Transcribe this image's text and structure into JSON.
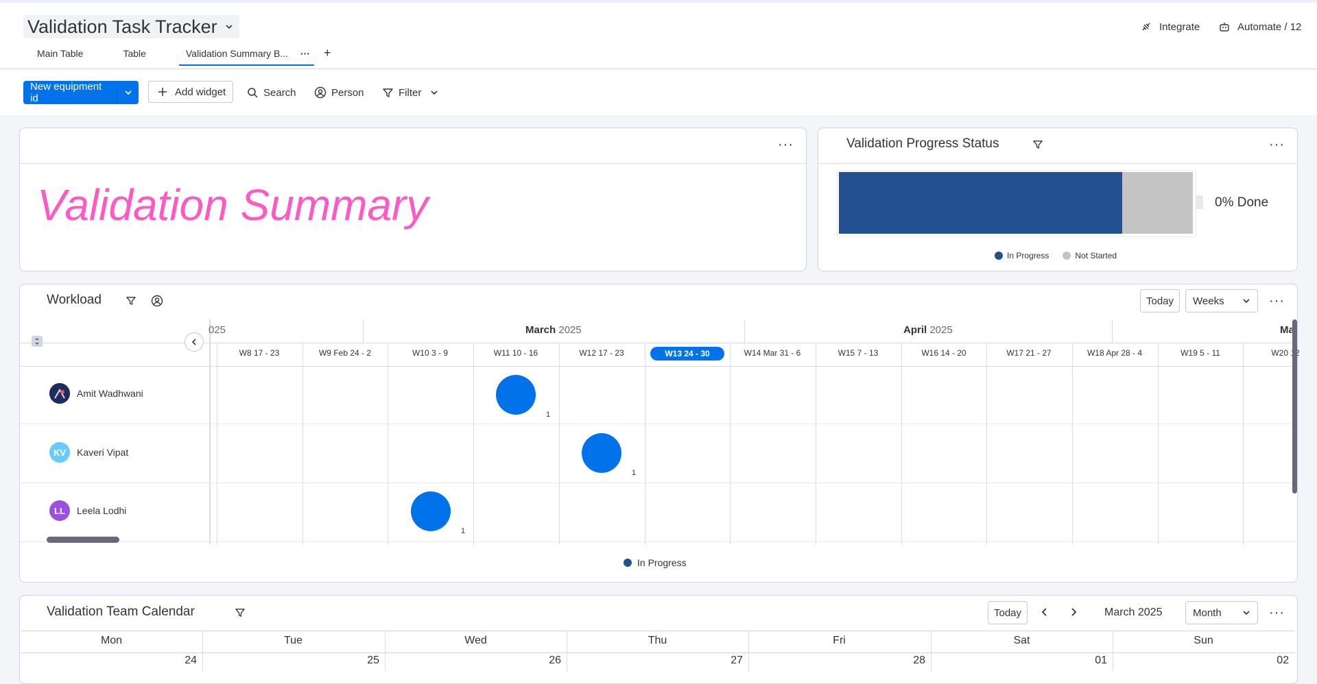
{
  "header": {
    "board_title": "Validation Task Tracker",
    "integrate_label": "Integrate",
    "automate_label": "Automate / 12",
    "tabs": [
      {
        "label": "Main Table"
      },
      {
        "label": "Table"
      },
      {
        "label": "Validation Summary B..."
      }
    ],
    "more_tabs": "···",
    "add_tab": "+"
  },
  "toolbar": {
    "new_item_label": "New equipment id",
    "add_widget_label": "Add widget",
    "search_label": "Search",
    "person_label": "Person",
    "filter_label": "Filter"
  },
  "text_widget": {
    "text": "Validation Summary",
    "text_color": "#ff5ac4",
    "menu": "···"
  },
  "progress_widget": {
    "title": "Validation Progress Status",
    "menu": "···",
    "done_label": "0% Done",
    "in_progress_fraction": 0.8,
    "not_started_fraction": 0.2,
    "legend": [
      {
        "label": "In Progress",
        "color": "#225091"
      },
      {
        "label": "Not Started",
        "color": "#c4c4c4"
      }
    ]
  },
  "workload": {
    "title": "Workload",
    "today_label": "Today",
    "scale_label": "Weeks",
    "menu": "···",
    "months": [
      {
        "label": "025"
      },
      {
        "label": "March 2025"
      },
      {
        "label": "April 2025"
      },
      {
        "label": "Ma"
      }
    ],
    "weeks": [
      {
        "label": "W8 17 - 23"
      },
      {
        "label": "W9 Feb 24 - 2"
      },
      {
        "label": "W10 3 - 9"
      },
      {
        "label": "W11 10 - 16"
      },
      {
        "label": "W12 17 - 23"
      },
      {
        "label": "W13 24 - 30"
      },
      {
        "label": "W14 Mar 31 - 6"
      },
      {
        "label": "W15 7 - 13"
      },
      {
        "label": "W16 14 - 20"
      },
      {
        "label": "W17 21 - 27"
      },
      {
        "label": "W18 Apr 28 - 4"
      },
      {
        "label": "W19 5 - 11"
      },
      {
        "label": "W20 12"
      }
    ],
    "current_week": "W13 24 - 30",
    "people": [
      {
        "name": "Amit Wadhwani",
        "initials": "",
        "avatar_color": "#1f2d5c",
        "week": "W11 10 - 16",
        "count": "1"
      },
      {
        "name": "Kaveri Vipat",
        "initials": "KV",
        "avatar_color": "#66ccff",
        "week": "W12 17 - 23",
        "count": "1"
      },
      {
        "name": "Leela Lodhi",
        "initials": "LL",
        "avatar_color": "#9d50dd",
        "week": "W10 3 - 9",
        "count": "1"
      }
    ],
    "legend_label": "In Progress",
    "legend_color": "#225091",
    "bubble_color": "#0073ea"
  },
  "calendar": {
    "title": "Validation Team Calendar",
    "today_label": "Today",
    "month_label": "March 2025",
    "view_label": "Month",
    "menu": "···",
    "days": [
      {
        "name": "Mon",
        "date": "24"
      },
      {
        "name": "Tue",
        "date": "25"
      },
      {
        "name": "Wed",
        "date": "26"
      },
      {
        "name": "Thu",
        "date": "27"
      },
      {
        "name": "Fri",
        "date": "28"
      },
      {
        "name": "Sat",
        "date": "01"
      },
      {
        "name": "Sun",
        "date": "02"
      }
    ]
  }
}
